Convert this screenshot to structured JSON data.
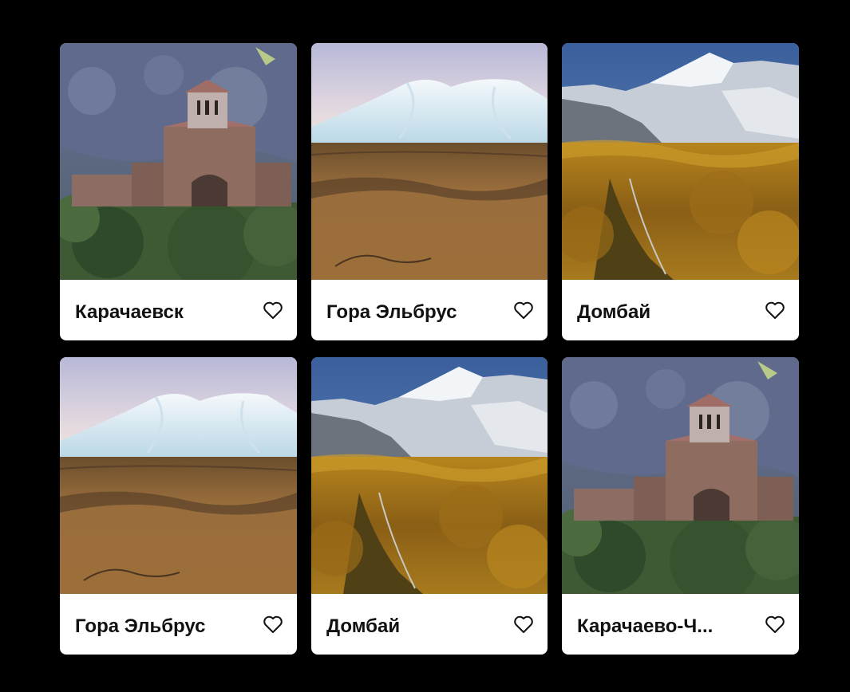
{
  "cards": [
    {
      "title": "Карачаевск",
      "scene": "church",
      "icon": "heart-outline-icon"
    },
    {
      "title": "Гора Эльбрус",
      "scene": "elbrus",
      "icon": "heart-outline-icon"
    },
    {
      "title": "Домбай",
      "scene": "dombay",
      "icon": "heart-outline-icon"
    },
    {
      "title": "Гора Эльбрус",
      "scene": "elbrus",
      "icon": "heart-outline-icon"
    },
    {
      "title": "Домбай",
      "scene": "dombay",
      "icon": "heart-outline-icon"
    },
    {
      "title": "Карачаево-Ч...",
      "scene": "church",
      "icon": "heart-outline-icon"
    }
  ],
  "colors": {
    "background": "#000000",
    "card": "#ffffff",
    "title": "#111111"
  }
}
